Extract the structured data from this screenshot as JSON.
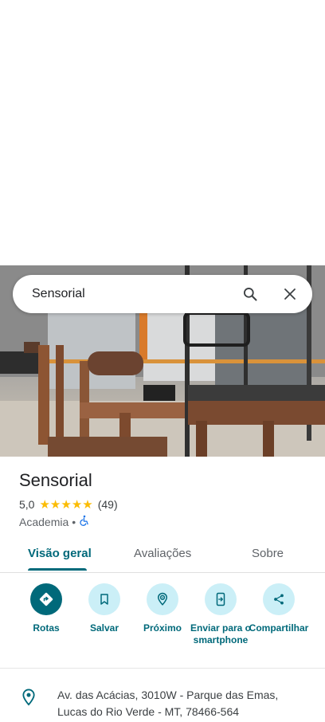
{
  "search": {
    "query": "Sensorial"
  },
  "place": {
    "title": "Sensorial",
    "rating": "5,0",
    "reviews_count": "(49)",
    "category": "Academia",
    "separator": "•"
  },
  "tabs": [
    {
      "label": "Visão geral",
      "active": true
    },
    {
      "label": "Avaliações",
      "active": false
    },
    {
      "label": "Sobre",
      "active": false
    }
  ],
  "actions": [
    {
      "label": "Rotas",
      "icon": "directions-icon"
    },
    {
      "label": "Salvar",
      "icon": "bookmark-icon"
    },
    {
      "label": "Próximo",
      "icon": "nearby-icon"
    },
    {
      "label": "Enviar para o smartphone",
      "icon": "send-to-phone-icon"
    },
    {
      "label": "Compartilhar",
      "icon": "share-icon"
    }
  ],
  "address": {
    "line1": "Av. das Acácias, 3010W - Parque das Emas,",
    "line2": "Lucas do Rio Verde - MT, 78466-564"
  },
  "colors": {
    "accent": "#00697a",
    "accent_light": "#cbeff7",
    "star": "#fbbc04"
  }
}
